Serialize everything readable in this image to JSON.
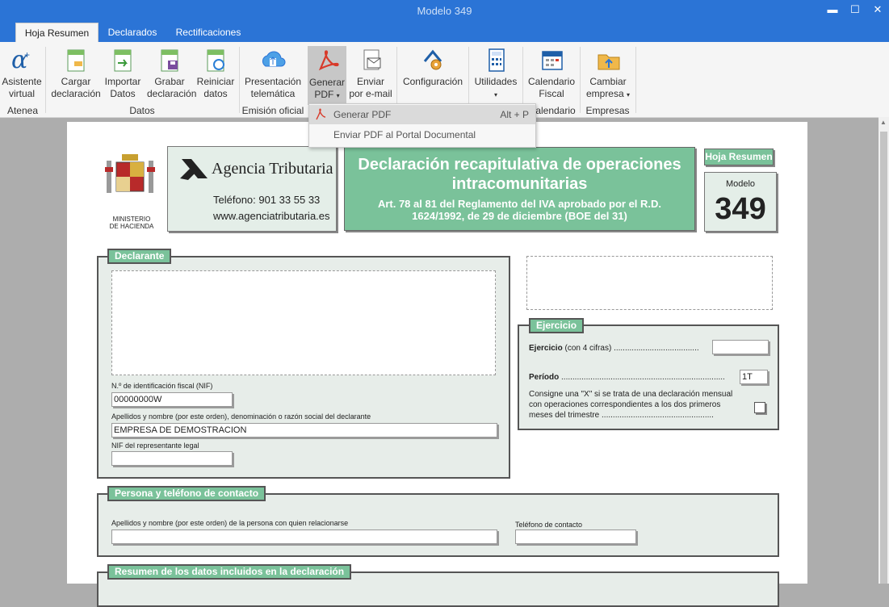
{
  "window": {
    "title": "Modelo 349"
  },
  "tabs": [
    "Hoja Resumen",
    "Declarados",
    "Rectificaciones"
  ],
  "ribbon": {
    "asistente": [
      "Asistente",
      "virtual"
    ],
    "cargar": [
      "Cargar",
      "declaración"
    ],
    "importar": [
      "Importar",
      "Datos"
    ],
    "grabar": [
      "Grabar",
      "declaración"
    ],
    "reiniciar": [
      "Reiniciar",
      "datos"
    ],
    "presentacion": [
      "Presentación",
      "telemática"
    ],
    "generar": [
      "Generar",
      "PDF"
    ],
    "enviar": [
      "Enviar",
      "por e-mail"
    ],
    "configuracion": "Configuración",
    "utilidades": "Utilidades",
    "calendario": [
      "Calendario",
      "Fiscal"
    ],
    "cambiar": [
      "Cambiar",
      "empresa"
    ],
    "groups": {
      "atenea": "Atenea",
      "datos": "Datos",
      "emision": "Emisión oficial",
      "calendario_partial": "alendario",
      "empresas": "Empresas"
    }
  },
  "dropdown": {
    "item1": "Generar PDF",
    "item1_shortcut": "Alt + P",
    "item2": "Enviar PDF al Portal Documental"
  },
  "doc": {
    "ministerio": [
      "MINISTERIO",
      "DE HACIENDA"
    ],
    "agencia": "Agencia Tributaria",
    "telefono": "Teléfono: 901 33 55 33",
    "web": "www.agenciatributaria.es",
    "title1": "Declaración recapitulativa de operaciones",
    "title2": "intracomunitarias",
    "subtitle1": "Art. 78 al 81 del Reglamento del IVA aprobado por el R.D.",
    "subtitle2": "1624/1992, de 29 de diciembre (BOE del 31)",
    "hoja_resumen": "Hoja Resumen",
    "modelo_label": "Modelo",
    "modelo": "349",
    "declarante": {
      "title": "Declarante",
      "nif_label": "N.º de identificación fiscal (NIF)",
      "nif": "00000000W",
      "nombre_label": "Apellidos y nombre (por este orden), denominación o razón social del declarante",
      "nombre": "EMPRESA DE DEMOSTRACION",
      "rep_label": "NIF del representante legal",
      "rep": ""
    },
    "ejercicio": {
      "title": "Ejercicio",
      "ej_label": "Ejercicio",
      "ej_hint": "(con 4 cifras)",
      "dots1": "......................................",
      "ej_value": "",
      "periodo_label": "Período",
      "dots2": ".........................................................................",
      "periodo": "1T",
      "consigne1": "Consigne una \"X\" si se trata de una declaración mensual",
      "consigne2": "con operaciones correspondientes a los dos primeros",
      "consigne3": "meses del trimestre .................................................."
    },
    "contacto": {
      "title": "Persona y teléfono de contacto",
      "persona_label": "Apellidos y nombre (por este orden) de la persona con quien relacionarse",
      "telefono_label": "Teléfono de contacto",
      "persona": "",
      "telefono": ""
    },
    "resumen": {
      "title": "Resumen de los datos incluidos en la declaración"
    }
  },
  "colors": {
    "titlebar": "#2b74d6",
    "green": "#7ac29a",
    "section_bg": "#e7ede9"
  }
}
